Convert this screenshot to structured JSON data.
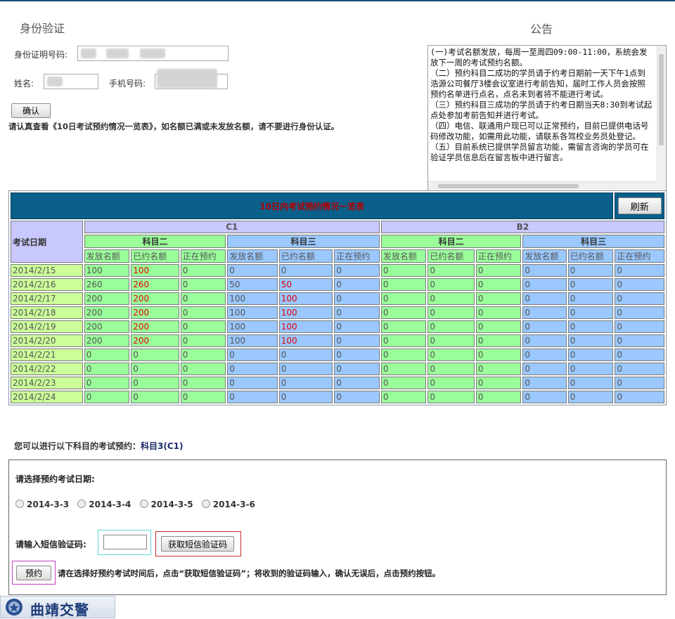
{
  "identity": {
    "title": "身份验证",
    "id_label": "身份证明号码:",
    "name_label": "姓名:",
    "phone_label": "手机号码:",
    "confirm_button": "确认",
    "warning": "请认真查看《10日考试预约情况一览表》，如名额已满或未发放名额，请不要进行身份认证。"
  },
  "notice": {
    "title": "公告",
    "text": "(一)考试名额发放，每周一至周四09:00-11:00，系统会发放下一周的考试预约名额。\n（二）预约科目二成功的学员请于约考日期前一天下午1点到浩源公司餐厅3楼会议室进行考前告知，届时工作人员会按照预约名单进行点名，点名未到者将不能进行考试。\n（三）预约科目三成功的学员请于约考日期当天8:30到考试起点处参加考前告知并进行考试。\n（四）电信、联通用户现已可以正常预约，目前已提供电话号码修改功能，如需用此功能，请联系各驾校业务员处登记。\n（五）目前系统已提供学员留言功能，需留言咨询的学员可在验证学员信息后在留言板中进行留言。"
  },
  "schedule": {
    "title": "10日内考试预约情况一览表",
    "refresh_button": "刷新",
    "date_header": "考试日期",
    "licenses": [
      "C1",
      "B2"
    ],
    "subjects": [
      "科目二",
      "科目三",
      "科目二",
      "科目三"
    ],
    "columns": [
      "发放名额",
      "已约名额",
      "正在预约"
    ],
    "rows": [
      {
        "date": "2014/2/15",
        "v": [
          "100",
          "100",
          "0",
          "0",
          "0",
          "0",
          "0",
          "0",
          "0",
          "0",
          "0",
          "0"
        ]
      },
      {
        "date": "2014/2/16",
        "v": [
          "260",
          "260",
          "0",
          "50",
          "50",
          "0",
          "0",
          "0",
          "0",
          "0",
          "0",
          "0"
        ]
      },
      {
        "date": "2014/2/17",
        "v": [
          "200",
          "200",
          "0",
          "100",
          "100",
          "0",
          "0",
          "0",
          "0",
          "0",
          "0",
          "0"
        ]
      },
      {
        "date": "2014/2/18",
        "v": [
          "200",
          "200",
          "0",
          "100",
          "100",
          "0",
          "0",
          "0",
          "0",
          "0",
          "0",
          "0"
        ]
      },
      {
        "date": "2014/2/19",
        "v": [
          "200",
          "200",
          "0",
          "100",
          "100",
          "0",
          "0",
          "0",
          "0",
          "0",
          "0",
          "0"
        ]
      },
      {
        "date": "2014/2/20",
        "v": [
          "200",
          "200",
          "0",
          "100",
          "100",
          "0",
          "0",
          "0",
          "0",
          "0",
          "0",
          "0"
        ]
      },
      {
        "date": "2014/2/21",
        "v": [
          "0",
          "0",
          "0",
          "0",
          "0",
          "0",
          "0",
          "0",
          "0",
          "0",
          "0",
          "0"
        ]
      },
      {
        "date": "2014/2/22",
        "v": [
          "0",
          "0",
          "0",
          "0",
          "0",
          "0",
          "0",
          "0",
          "0",
          "0",
          "0",
          "0"
        ]
      },
      {
        "date": "2014/2/23",
        "v": [
          "0",
          "0",
          "0",
          "0",
          "0",
          "0",
          "0",
          "0",
          "0",
          "0",
          "0",
          "0"
        ]
      },
      {
        "date": "2014/2/24",
        "v": [
          "0",
          "0",
          "0",
          "0",
          "0",
          "0",
          "0",
          "0",
          "0",
          "0",
          "0",
          "0"
        ]
      }
    ]
  },
  "booking": {
    "eligible_prefix": "您可以进行以下科目的考试预约：",
    "eligible_subject": "科目3(C1)",
    "choose_date": "请选择预约考试日期:",
    "dates": [
      "2014-3-3",
      "2014-3-4",
      "2014-3-5",
      "2014-3-6"
    ],
    "sms_label": "请输入短信验证码:",
    "sms_button": "获取短信验证码",
    "book_button": "预约",
    "instruction": "请在选择好预约考试时间后，点击“获取短信验证码”；将收到的验证码输入，确认无误后，点击预约按钮。"
  },
  "footer": {
    "logo_text": "曲靖交警"
  },
  "colors": {
    "header_bg": "#0a5f8b",
    "title_red": "#b30000",
    "green_cell": "#9aff9a",
    "blue_cell": "#9ac8ff",
    "date_cell": "#ccff9a",
    "license_row": "#c8c8ff"
  }
}
